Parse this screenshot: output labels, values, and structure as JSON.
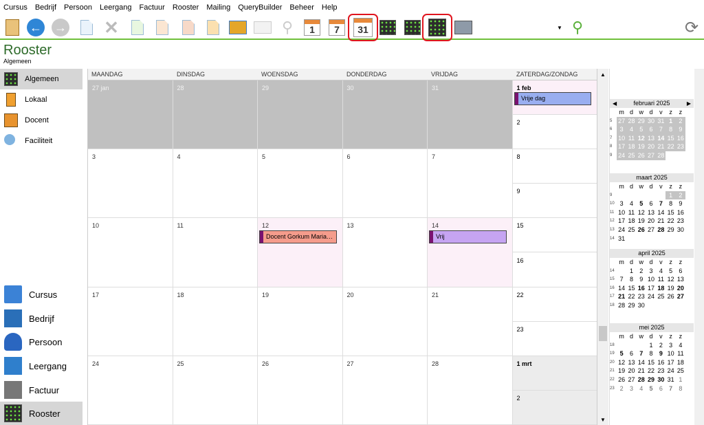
{
  "menu": [
    "Cursus",
    "Bedrijf",
    "Persoon",
    "Leergang",
    "Factuur",
    "Rooster",
    "Mailing",
    "QueryBuilder",
    "Beheer",
    "Help"
  ],
  "toolbar": {
    "cal1": "1",
    "cal7": "7",
    "cal31": "31"
  },
  "header": {
    "title": "Rooster",
    "subtitle": "Algemeen"
  },
  "sidebar": {
    "top": [
      {
        "label": "Algemeen",
        "icon": "rooster-grid-icon"
      },
      {
        "label": "Lokaal",
        "icon": "door-icon"
      },
      {
        "label": "Docent",
        "icon": "teacher-icon"
      },
      {
        "label": "Faciliteit",
        "icon": "projector-icon"
      }
    ],
    "bottom": [
      {
        "label": "Cursus",
        "icon": "book-icon"
      },
      {
        "label": "Bedrijf",
        "icon": "building-icon"
      },
      {
        "label": "Persoon",
        "icon": "person-icon"
      },
      {
        "label": "Leergang",
        "icon": "books-icon"
      },
      {
        "label": "Factuur",
        "icon": "cash-register-icon"
      },
      {
        "label": "Rooster",
        "icon": "rooster-grid-icon"
      }
    ]
  },
  "calendar": {
    "headers": [
      "MAANDAG",
      "DINSDAG",
      "WOENSDAG",
      "DONDERDAG",
      "VRIJDAG",
      "ZATERDAG/ZONDAG"
    ],
    "weeks": [
      {
        "days": [
          "27 jan",
          "28",
          "29",
          "30",
          "31"
        ],
        "sat": "1 feb",
        "sun": "2"
      },
      {
        "days": [
          "3",
          "4",
          "5",
          "6",
          "7"
        ],
        "sat": "8",
        "sun": "9"
      },
      {
        "days": [
          "10",
          "11",
          "12",
          "13",
          "14"
        ],
        "sat": "15",
        "sun": "16"
      },
      {
        "days": [
          "17",
          "18",
          "19",
          "20",
          "21"
        ],
        "sat": "22",
        "sun": "23"
      },
      {
        "days": [
          "24",
          "25",
          "26",
          "27",
          "28"
        ],
        "sat": "1 mrt",
        "sun": "2"
      }
    ],
    "events": {
      "vrije_dag": "Vrije dag",
      "docent": "Docent Gorkum Maria…",
      "vrij": "Vrij"
    }
  },
  "minical": {
    "dayhdr": [
      "m",
      "d",
      "w",
      "d",
      "v",
      "z",
      "z"
    ],
    "months": [
      {
        "title": "februari 2025",
        "weeks": [
          {
            "wk": "5",
            "d": [
              "27",
              "28",
              "29",
              "30",
              "31",
              "1",
              "2"
            ]
          },
          {
            "wk": "6",
            "d": [
              "3",
              "4",
              "5",
              "6",
              "7",
              "8",
              "9"
            ]
          },
          {
            "wk": "7",
            "d": [
              "10",
              "11",
              "12",
              "13",
              "14",
              "15",
              "16"
            ]
          },
          {
            "wk": "8",
            "d": [
              "17",
              "18",
              "19",
              "20",
              "21",
              "22",
              "23"
            ]
          },
          {
            "wk": "9",
            "d": [
              "24",
              "25",
              "26",
              "27",
              "28",
              "",
              ""
            ]
          }
        ]
      },
      {
        "title": "maart 2025",
        "weeks": [
          {
            "wk": "9",
            "d": [
              "",
              "",
              "",
              "",
              "",
              "1",
              "2"
            ]
          },
          {
            "wk": "10",
            "d": [
              "3",
              "4",
              "5",
              "6",
              "7",
              "8",
              "9"
            ]
          },
          {
            "wk": "11",
            "d": [
              "10",
              "11",
              "12",
              "13",
              "14",
              "15",
              "16"
            ]
          },
          {
            "wk": "12",
            "d": [
              "17",
              "18",
              "19",
              "20",
              "21",
              "22",
              "23"
            ]
          },
          {
            "wk": "13",
            "d": [
              "24",
              "25",
              "26",
              "27",
              "28",
              "29",
              "30"
            ]
          },
          {
            "wk": "14",
            "d": [
              "31",
              "",
              "",
              "",
              "",
              "",
              ""
            ]
          }
        ]
      },
      {
        "title": "april 2025",
        "weeks": [
          {
            "wk": "14",
            "d": [
              "",
              "1",
              "2",
              "3",
              "4",
              "5",
              "6"
            ]
          },
          {
            "wk": "15",
            "d": [
              "7",
              "8",
              "9",
              "10",
              "11",
              "12",
              "13"
            ]
          },
          {
            "wk": "16",
            "d": [
              "14",
              "15",
              "16",
              "17",
              "18",
              "19",
              "20"
            ]
          },
          {
            "wk": "17",
            "d": [
              "21",
              "22",
              "23",
              "24",
              "25",
              "26",
              "27"
            ]
          },
          {
            "wk": "18",
            "d": [
              "28",
              "29",
              "30",
              "",
              "",
              "",
              ""
            ]
          }
        ]
      },
      {
        "title": "mei 2025",
        "weeks": [
          {
            "wk": "18",
            "d": [
              "",
              "",
              "",
              "1",
              "2",
              "3",
              "4"
            ]
          },
          {
            "wk": "19",
            "d": [
              "5",
              "6",
              "7",
              "8",
              "9",
              "10",
              "11"
            ]
          },
          {
            "wk": "20",
            "d": [
              "12",
              "13",
              "14",
              "15",
              "16",
              "17",
              "18"
            ]
          },
          {
            "wk": "21",
            "d": [
              "19",
              "20",
              "21",
              "22",
              "23",
              "24",
              "25"
            ]
          },
          {
            "wk": "22",
            "d": [
              "26",
              "27",
              "28",
              "29",
              "30",
              "31",
              "1"
            ]
          },
          {
            "wk": "23",
            "d": [
              "2",
              "3",
              "4",
              "5",
              "6",
              "7",
              "8"
            ]
          }
        ]
      }
    ]
  }
}
